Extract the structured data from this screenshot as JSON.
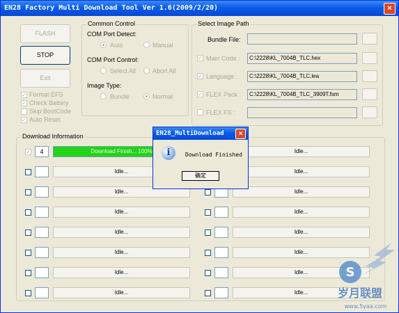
{
  "window": {
    "title": "EN28 Factory Multi Download Tool Ver 1.6(2009/2/20)",
    "close_glyph": "×"
  },
  "buttons": {
    "flash": "FLASH",
    "stop": "STOP",
    "exit": "Exit"
  },
  "options": [
    {
      "label": "Format EFS",
      "checked": true
    },
    {
      "label": "Check Battery",
      "checked": true
    },
    {
      "label": "Skip BootCode",
      "checked": false
    },
    {
      "label": "Auto Reset",
      "checked": true
    }
  ],
  "common_control": {
    "title": "Common Control",
    "port_detect_label": "COM Port Detect:",
    "auto": "Auto",
    "manual": "Manual",
    "port_control_label": "COM Port Control:",
    "select_all": "Select All",
    "abort_all": "Abort All",
    "image_type_label": "Image Type:",
    "bundle": "Bundle",
    "normal": "Normal"
  },
  "image_path": {
    "title": "Select Image Path",
    "bundle_file_label": "Bundle File:",
    "bundle_file_value": "",
    "rows": [
      {
        "label": "Main Code :",
        "value": "C:\\2228\\KL_7004B_TLC.hex",
        "checked": true
      },
      {
        "label": "Language :",
        "value": "C:\\2228\\KL_7004B_TLC.lea",
        "checked": true
      },
      {
        "label": "FLEX Pack :",
        "value": "C:\\2228\\KL_7004B_TLC_3909T.fsm",
        "checked": true
      },
      {
        "label": "FLEX FS :",
        "value": "",
        "checked": false
      }
    ]
  },
  "download_info": {
    "title": "Download Information",
    "left": [
      {
        "num": "4",
        "status": "Download Finish... 100%",
        "checked": true,
        "active": true
      },
      {
        "num": "",
        "status": "Idle...",
        "checked": false,
        "active": false
      },
      {
        "num": "",
        "status": "Idle...",
        "checked": false,
        "active": false
      },
      {
        "num": "",
        "status": "Idle...",
        "checked": false,
        "active": false
      },
      {
        "num": "",
        "status": "Idle...",
        "checked": false,
        "active": false
      },
      {
        "num": "",
        "status": "Idle...",
        "checked": false,
        "active": false
      },
      {
        "num": "",
        "status": "Idle...",
        "checked": false,
        "active": false
      },
      {
        "num": "",
        "status": "Idle...",
        "checked": false,
        "active": false
      }
    ],
    "right": [
      {
        "num": "",
        "status": "Idle..."
      },
      {
        "num": "",
        "status": "Idle..."
      },
      {
        "num": "",
        "status": "Idle..."
      },
      {
        "num": "",
        "status": "Idle..."
      },
      {
        "num": "",
        "status": "Idle..."
      },
      {
        "num": "",
        "status": "Idle..."
      },
      {
        "num": "",
        "status": "Idle..."
      },
      {
        "num": "",
        "status": "Idle..."
      }
    ]
  },
  "dialog": {
    "title": "EN28_MultiDownload",
    "message": "Download Finished",
    "ok": "确定",
    "icon": "info-icon"
  },
  "watermark": {
    "text": "岁月联盟",
    "url": "www.5yaa.com"
  },
  "colors": {
    "title_bar": "#0a5ce8",
    "progress": "#22d318",
    "face": "#ece9d8"
  }
}
